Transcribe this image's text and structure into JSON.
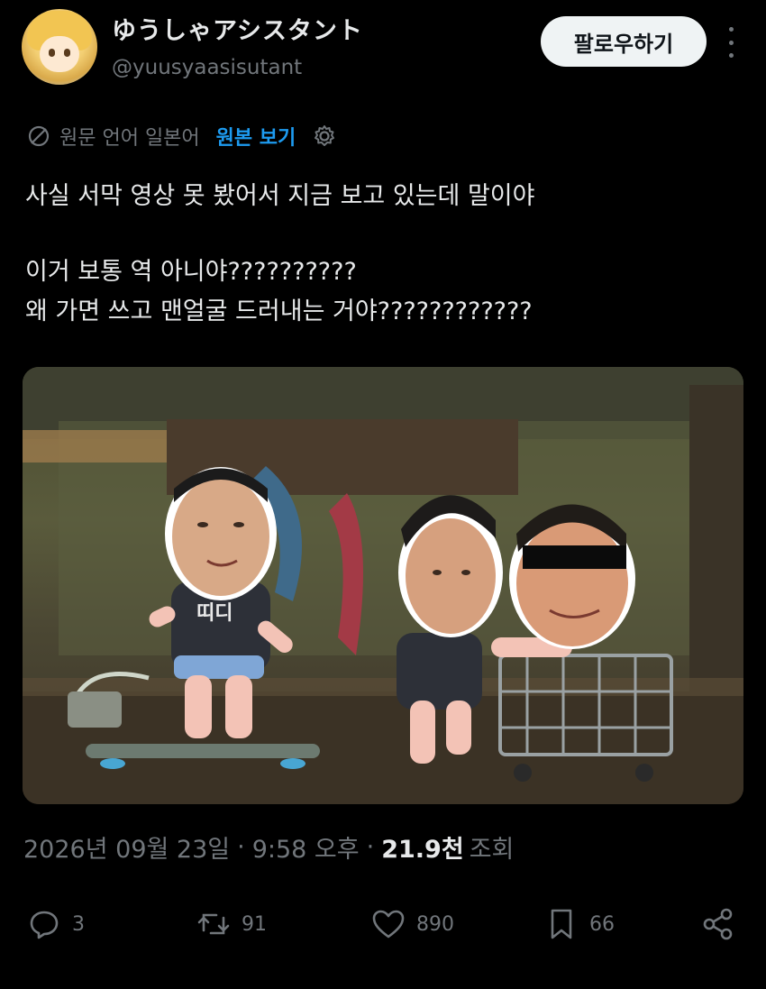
{
  "author": {
    "display_name": "ゆうしゃアシスタント",
    "handle": "@yuusyaasisutant",
    "avatar_icon": "anime-avatar"
  },
  "header": {
    "follow_label": "팔로우하기",
    "more_icon": "more-vertical-icon"
  },
  "translation": {
    "source_language_text": "원문 언어 일본어",
    "show_original_label": "원본 보기",
    "globe_icon": "translate-icon",
    "gear_icon": "settings-gear-icon"
  },
  "tweet": {
    "lines": [
      "사실 서막 영상 못 봤어서 지금 보고 있는데 말이야",
      "이거 보통 역 아니야??????????",
      "왜 가면 쓰고 맨얼굴 드러내는 거야????????????"
    ]
  },
  "media": {
    "shirt_text": "띠디"
  },
  "meta": {
    "date": "2026년 09월 23일",
    "time": "9:58 오후",
    "views_count": "21.9천",
    "views_label": "조회",
    "separator": "·"
  },
  "actions": {
    "reply": {
      "icon": "reply-icon",
      "count": "3"
    },
    "repost": {
      "icon": "repost-icon",
      "count": "91"
    },
    "like": {
      "icon": "heart-icon",
      "count": "890"
    },
    "bookmark": {
      "icon": "bookmark-icon",
      "count": "66"
    },
    "share": {
      "icon": "share-icon"
    }
  },
  "colors": {
    "background": "#000000",
    "primary_text": "#e7e9ea",
    "secondary_text": "#71767b",
    "link": "#1d9bf0",
    "follow_button_bg": "#eff3f4"
  }
}
